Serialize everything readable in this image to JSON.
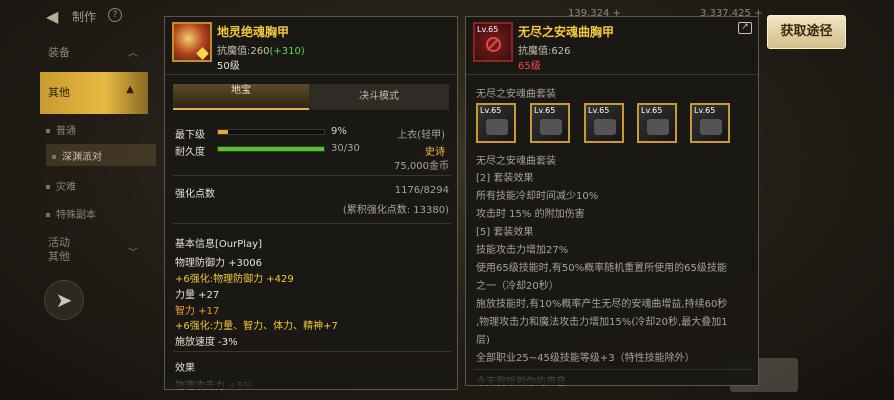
{
  "topbar": {
    "title": "制作",
    "help": "?",
    "num1": "139,324 +",
    "num2": "3,337,425 +"
  },
  "sidebar": {
    "items": [
      {
        "label": "装备"
      },
      {
        "label": "其他"
      },
      {
        "label": "普通"
      },
      {
        "label": "深渊派对"
      },
      {
        "label": "灾难"
      },
      {
        "label": "特殊副本"
      },
      {
        "label": "活动"
      },
      {
        "label": "其他"
      }
    ]
  },
  "obtain_button": "获取途径",
  "left": {
    "name": "地灵绝魂胸甲",
    "resist_label": "抗魔值:260",
    "resist_bonus": "(+310)",
    "level": "50级",
    "tabs": [
      "地宝",
      "决斗模式"
    ],
    "durability_rows": [
      {
        "label": "最下级",
        "value": "9%",
        "right": "上衣(轻甲)",
        "fill": 0.09,
        "color": "#e8a62a"
      },
      {
        "label": "耐久度",
        "value": "30/30",
        "right": "史诗",
        "fill": 1.0,
        "color": "#4bc92e"
      }
    ],
    "price": "75,000金币",
    "reinforce_label": "强化点数",
    "reinforce_value": "1176/8294",
    "reinforce_accum": "(累积强化点数: 13380)",
    "basic_title": "基本信息[OurPlay]",
    "basic_lines": [
      {
        "text": "物理防御力 +3006",
        "color": "white"
      },
      {
        "text": "+6强化:物理防御力 +429",
        "color": "yellow"
      },
      {
        "text": "力量 +27",
        "color": "white"
      },
      {
        "text": "智力 +17",
        "color": "orange"
      },
      {
        "text": "+6强化:力量、智力、体力、精神+7",
        "color": "yellow"
      },
      {
        "text": "施放速度 -3%",
        "color": "white"
      }
    ],
    "effect_title": "效果",
    "effect_partial": "物理攻击力 +5%"
  },
  "right": {
    "name": "无尽之安魂曲胸甲",
    "icon_level": "Lv.65",
    "resist_label": "抗魔值:626",
    "level": "65级",
    "set_title": "无尽之安魂曲套装",
    "set_icons": [
      "Lv.65",
      "Lv.65",
      "Lv.65",
      "Lv.65",
      "Lv.65"
    ],
    "lines": [
      "无尽之安魂曲套装",
      "[2] 套装效果",
      "所有技能冷却时间减少10%",
      "攻击时 15% 的附加伤害",
      "[5] 套装效果",
      "技能攻击力增加27%",
      "使用65级技能时,有50%概率随机重置所使用的65级技能",
      "之一（冷却20秒）",
      "施放技能时,有10%概率产生无尽的安魂曲增益,持续60秒",
      ",物理攻击力和魔法攻击力增加15%(冷却20秒,最大叠加1",
      "层)",
      "全部职业25~45级技能等级+3（特性技能除外）",
      "今天我听到你的声音"
    ]
  }
}
